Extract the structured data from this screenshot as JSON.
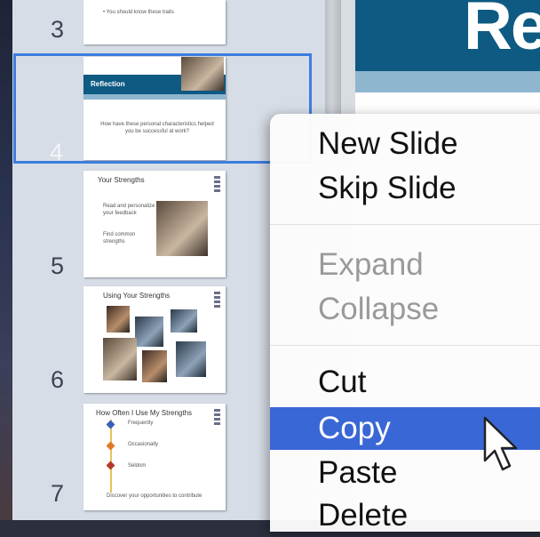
{
  "navigator": {
    "slides": [
      {
        "number": "3",
        "bullets": [
          "• You should know these traits"
        ]
      },
      {
        "number": "4",
        "title": "Reflection",
        "body": "How have these personal characteristics helped you be successful at work?"
      },
      {
        "number": "5",
        "title": "Your Strengths",
        "bullets": [
          "Read and personalize your feedback",
          "Find common strengths"
        ]
      },
      {
        "number": "6",
        "title": "Using Your Strengths"
      },
      {
        "number": "7",
        "title": "How Often I Use My Strengths",
        "items": [
          "Frequently",
          "Occasionally",
          "Seldom"
        ],
        "footer": "Discover your opportunities to contribute"
      }
    ]
  },
  "canvas": {
    "title_fragment": "Re"
  },
  "context_menu": {
    "items": [
      {
        "label": "New Slide",
        "enabled": true
      },
      {
        "label": "Skip Slide",
        "enabled": true
      },
      {
        "label": "Expand",
        "enabled": false
      },
      {
        "label": "Collapse",
        "enabled": false
      },
      {
        "label": "Cut",
        "enabled": true
      },
      {
        "label": "Copy",
        "enabled": true,
        "highlighted": true
      },
      {
        "label": "Paste",
        "enabled": true
      },
      {
        "label": "Delete",
        "enabled": true
      }
    ]
  },
  "colors": {
    "selection": "#3d7de0",
    "menu_highlight": "#3a67d6",
    "slide_banner": "#0e5a82"
  }
}
